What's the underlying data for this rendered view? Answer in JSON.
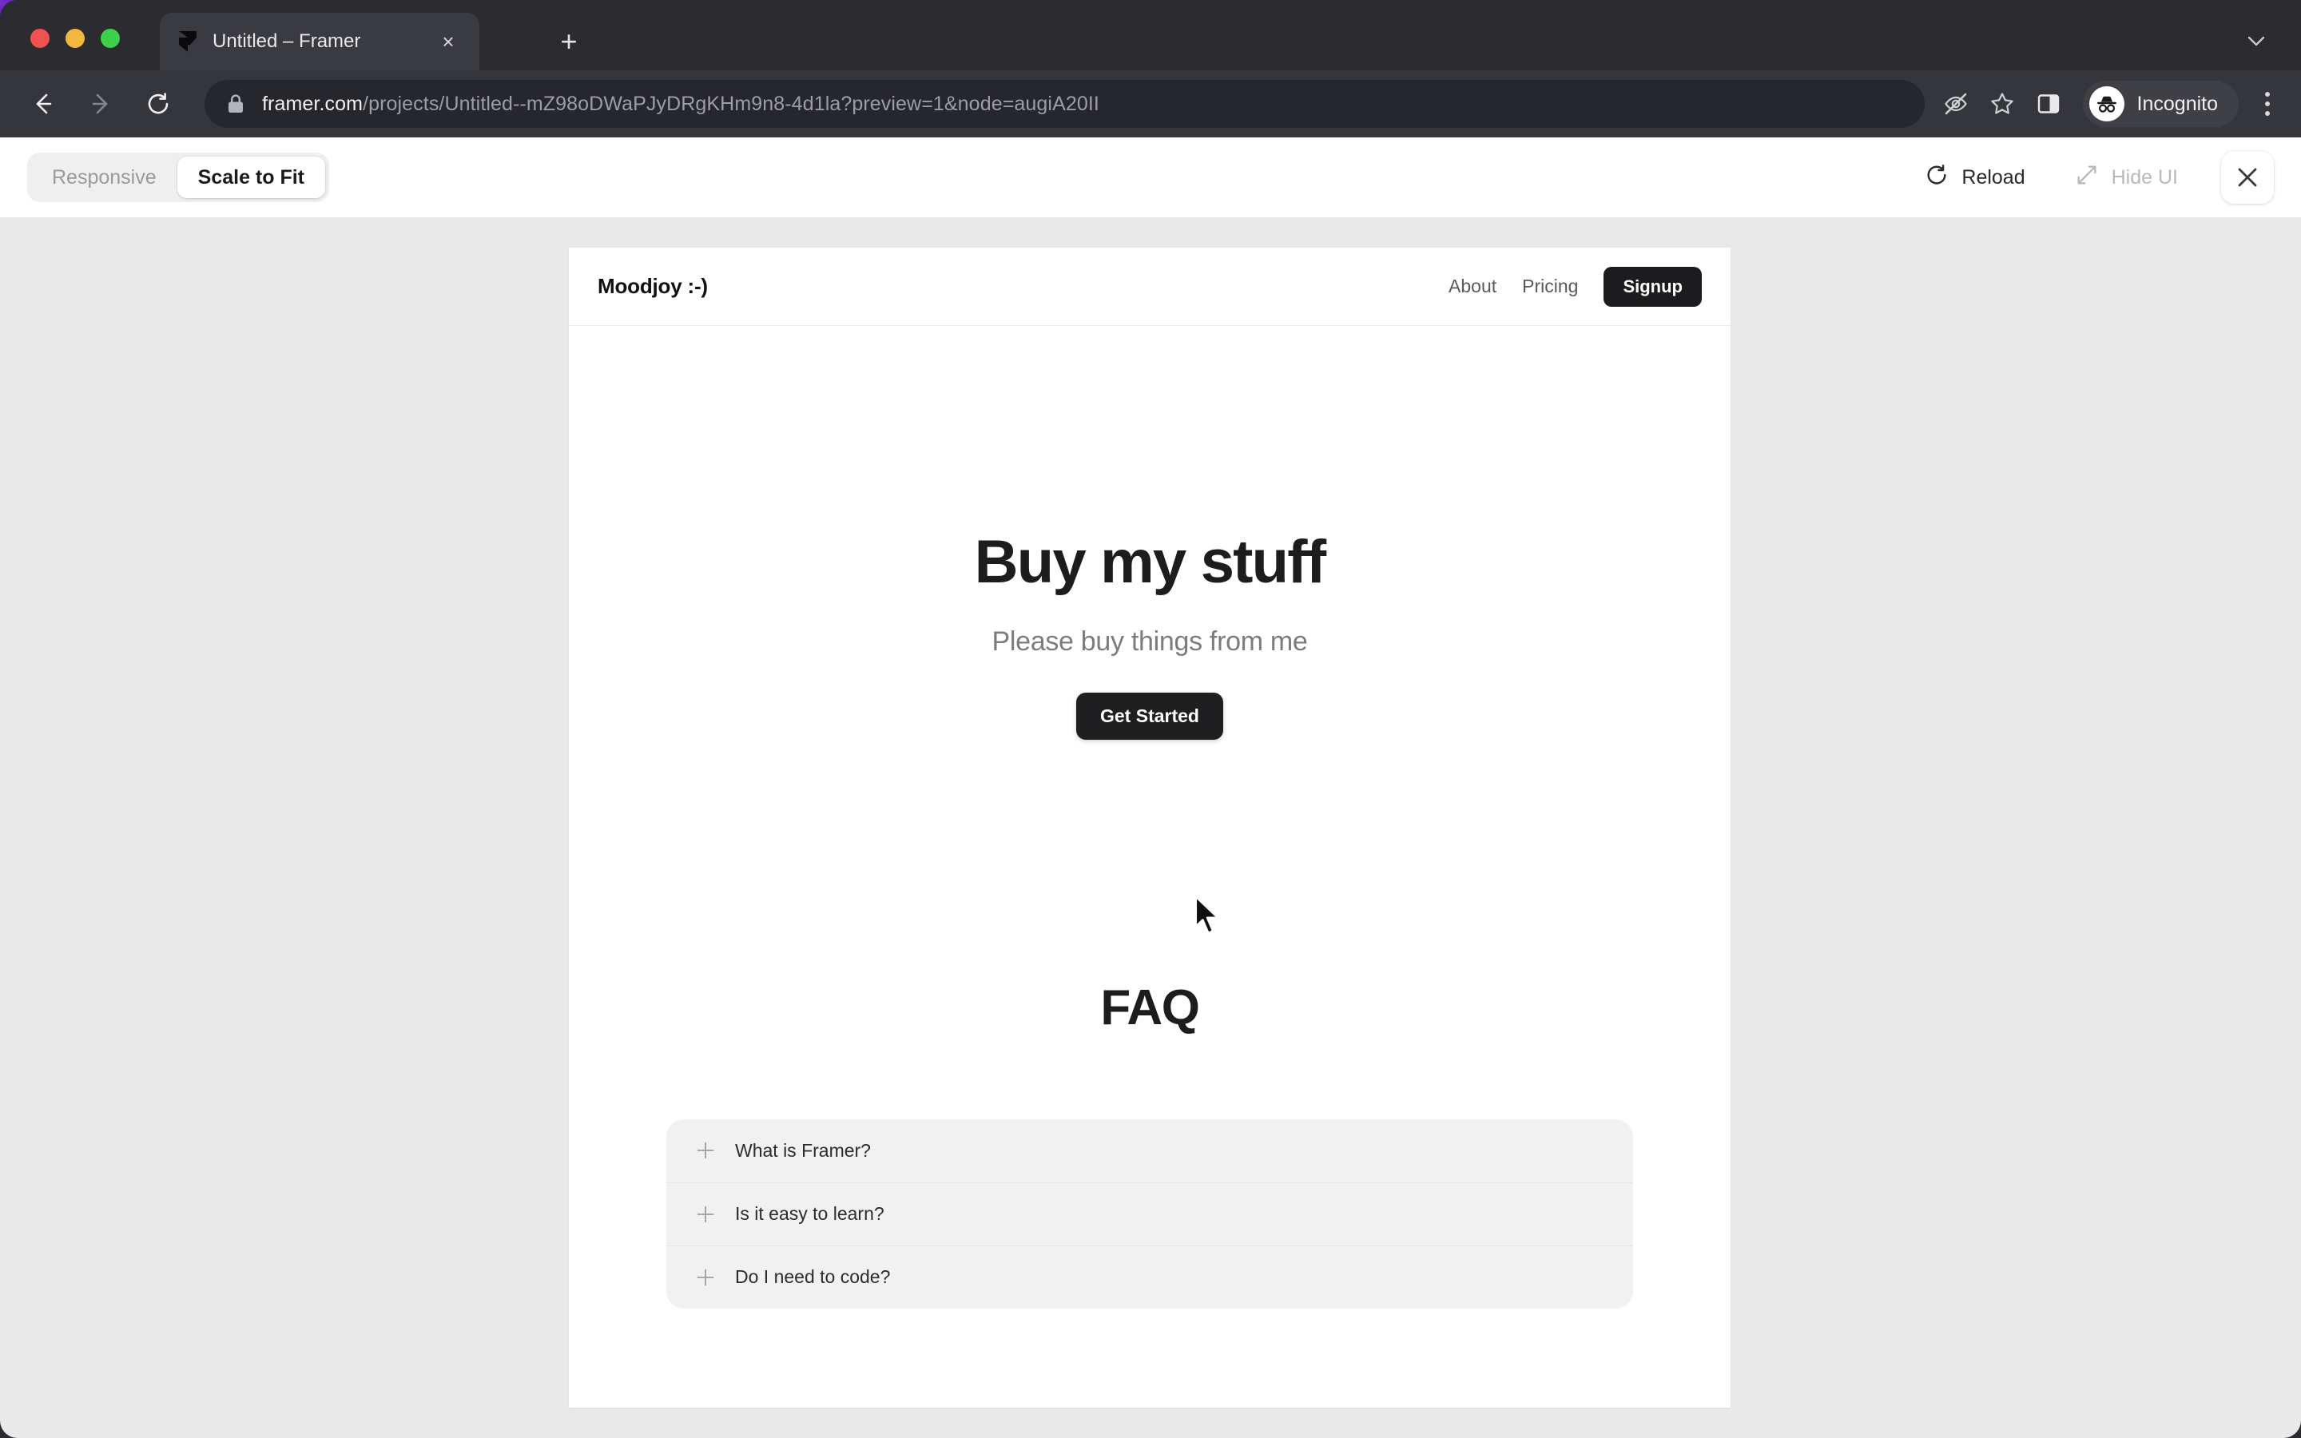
{
  "browser": {
    "tab": {
      "title": "Untitled – Framer",
      "favicon": "framer-logo-icon",
      "close": "×"
    },
    "new_tab_label": "+",
    "omnibox": {
      "host": "framer.com",
      "path": "/projects/Untitled--mZ98oDWaPJyDRgKHm9n8-4d1la?preview=1&node=augiA20II",
      "full_url": "framer.com/projects/Untitled--mZ98oDWaPJyDRgKHm9n8-4d1la?preview=1&node=augiA20II",
      "lock_icon": "lock-icon"
    },
    "nav": {
      "back": "back-arrow-icon",
      "forward": "forward-arrow-icon",
      "reload": "reload-icon"
    },
    "actions": {
      "tracking_protection": "eye-off-icon",
      "bookmark": "star-icon",
      "side_panel": "side-panel-icon",
      "menu": "kebab-menu-icon"
    },
    "profile": {
      "name": "Incognito",
      "avatar_icon": "incognito-icon"
    }
  },
  "framer_toolbar": {
    "segments": [
      {
        "label": "Responsive",
        "active": false
      },
      {
        "label": "Scale to Fit",
        "active": true
      }
    ],
    "reload": {
      "label": "Reload",
      "icon": "reload-icon"
    },
    "hide_ui": {
      "label": "Hide UI",
      "icon": "expand-arrow-icon"
    },
    "close": {
      "icon": "close-icon",
      "label": "×"
    }
  },
  "site": {
    "nav": {
      "logo": "Moodjoy :-)",
      "links": [
        {
          "label": "About"
        },
        {
          "label": "Pricing"
        }
      ],
      "cta": {
        "label": "Signup"
      }
    },
    "hero": {
      "title": "Buy my stuff",
      "subtitle": "Please buy things from me",
      "cta": {
        "label": "Get Started"
      }
    },
    "faq": {
      "title": "FAQ",
      "items": [
        {
          "question": "What is Framer?",
          "toggle_icon": "plus-icon"
        },
        {
          "question": "Is it easy to learn?",
          "toggle_icon": "plus-icon"
        },
        {
          "question": "Do I need to code?",
          "toggle_icon": "plus-icon"
        }
      ]
    }
  },
  "colors": {
    "browser_chrome": "#2b2b30",
    "omnibox_bar": "#35363c",
    "canvas_bg": "#e9e9e9",
    "site_bg": "#ffffff",
    "accent_dark": "#1c1c1e",
    "faq_card": "#f1f1f1"
  }
}
